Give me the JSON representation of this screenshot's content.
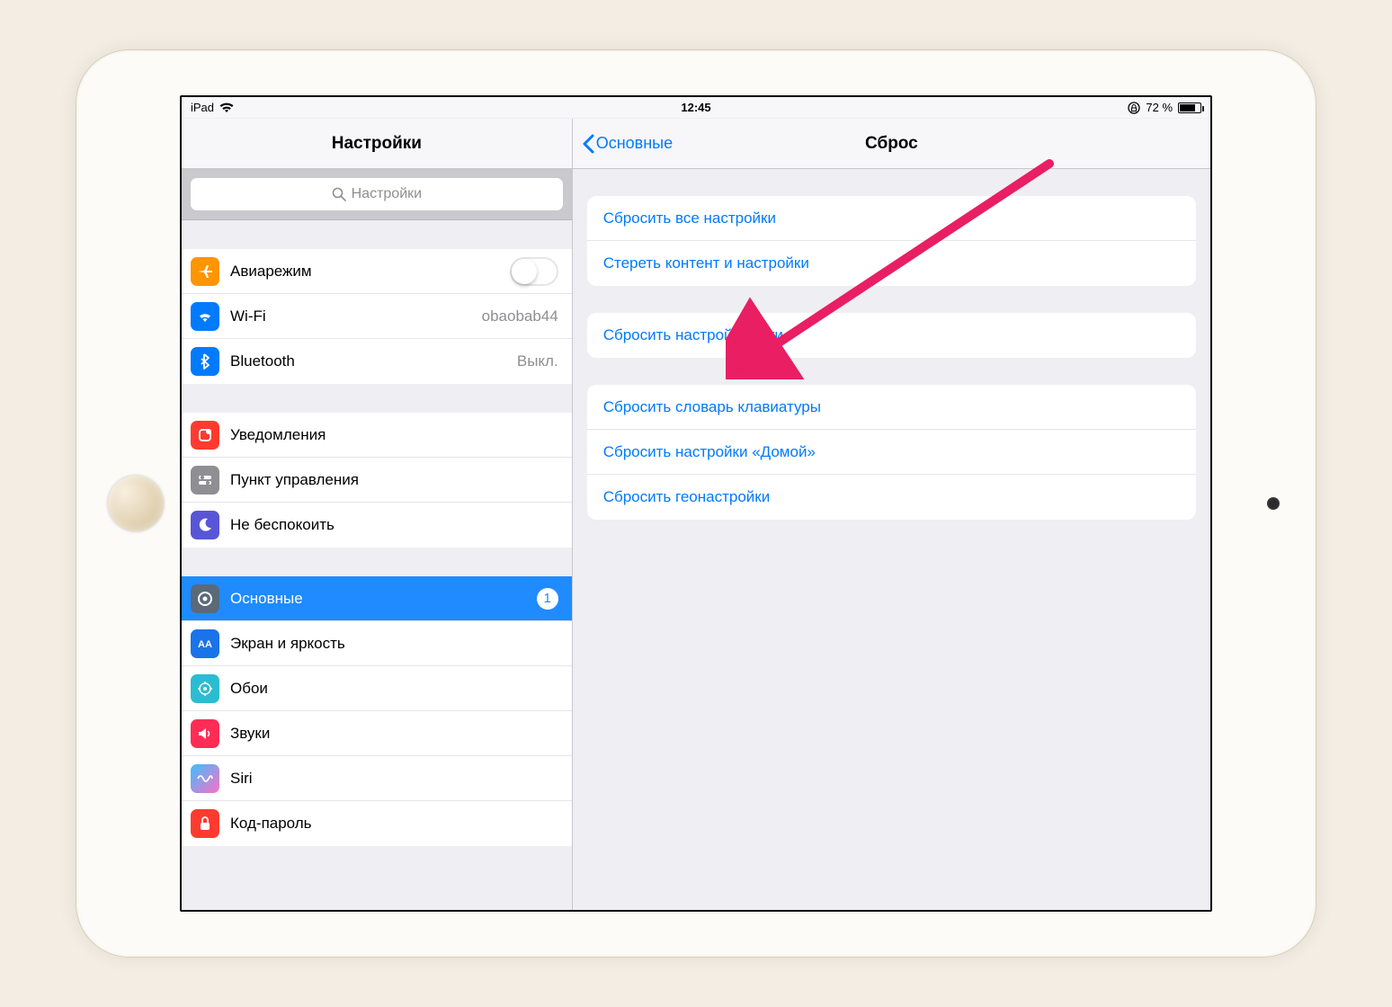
{
  "status": {
    "device": "iPad",
    "time": "12:45",
    "battery_percent": "72 %"
  },
  "sidebar": {
    "title": "Настройки",
    "search_placeholder": "Настройки",
    "groups": [
      {
        "items": [
          {
            "key": "airplane",
            "label": "Авиарежим",
            "type": "toggle",
            "value": ""
          },
          {
            "key": "wifi",
            "label": "Wi-Fi",
            "type": "value",
            "value": "obaobab44"
          },
          {
            "key": "bluetooth",
            "label": "Bluetooth",
            "type": "value",
            "value": "Выкл."
          }
        ]
      },
      {
        "items": [
          {
            "key": "notifications",
            "label": "Уведомления",
            "type": "link"
          },
          {
            "key": "controlcenter",
            "label": "Пункт управления",
            "type": "link"
          },
          {
            "key": "dnd",
            "label": "Не беспокоить",
            "type": "link"
          }
        ]
      },
      {
        "items": [
          {
            "key": "general",
            "label": "Основные",
            "type": "badge",
            "value": "1",
            "selected": true
          },
          {
            "key": "display",
            "label": "Экран и яркость",
            "type": "link"
          },
          {
            "key": "wallpaper",
            "label": "Обои",
            "type": "link"
          },
          {
            "key": "sounds",
            "label": "Звуки",
            "type": "link"
          },
          {
            "key": "siri",
            "label": "Siri",
            "type": "link"
          },
          {
            "key": "passcode",
            "label": "Код-пароль",
            "type": "link"
          }
        ]
      }
    ]
  },
  "main": {
    "back_label": "Основные",
    "title": "Сброс",
    "groups": [
      [
        "Сбросить все настройки",
        "Стереть контент и настройки"
      ],
      [
        "Сбросить настройки сети"
      ],
      [
        "Сбросить словарь клавиатуры",
        "Сбросить настройки «Домой»",
        "Сбросить геонастройки"
      ]
    ]
  },
  "colors": {
    "accent": "#007aff",
    "arrow": "#e91e63"
  }
}
